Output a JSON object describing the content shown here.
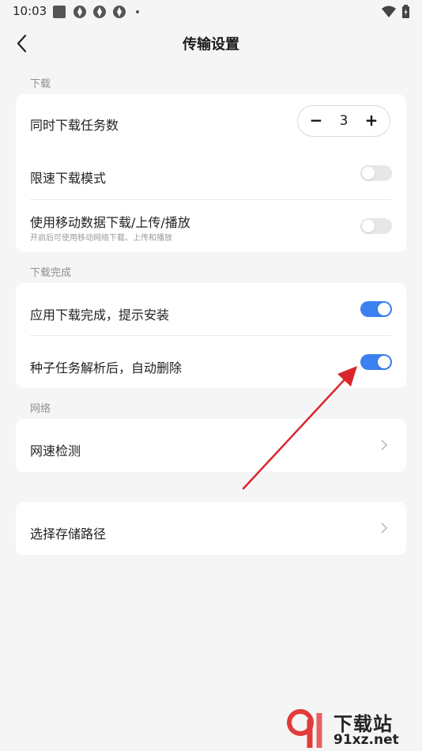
{
  "status_bar": {
    "time": "10:03"
  },
  "header": {
    "title": "传输设置"
  },
  "sections": {
    "download": {
      "label": "下载",
      "concurrent": {
        "label": "同时下载任务数",
        "value": "3",
        "minus": "−",
        "plus": "+"
      },
      "speed_limit": {
        "label": "限速下载模式",
        "enabled": false
      },
      "mobile_data": {
        "label": "使用移动数据下载/上传/播放",
        "sub": "开启后可使用移动网络下载、上传和播放",
        "enabled": false
      }
    },
    "download_complete": {
      "label": "下载完成",
      "install_prompt": {
        "label": "应用下载完成，提示安装",
        "enabled": true
      },
      "torrent_delete": {
        "label": "种子任务解析后，自动删除",
        "enabled": true
      }
    },
    "network": {
      "label": "网络",
      "speed_test": {
        "label": "网速检测"
      }
    },
    "storage": {
      "path": {
        "label": "选择存储路径"
      }
    }
  },
  "watermark": {
    "brand": "下载站",
    "url": "91xz.net"
  },
  "colors": {
    "accent": "#3b82f0",
    "annotation_arrow": "#d9262c",
    "background": "#f5f5f6"
  }
}
